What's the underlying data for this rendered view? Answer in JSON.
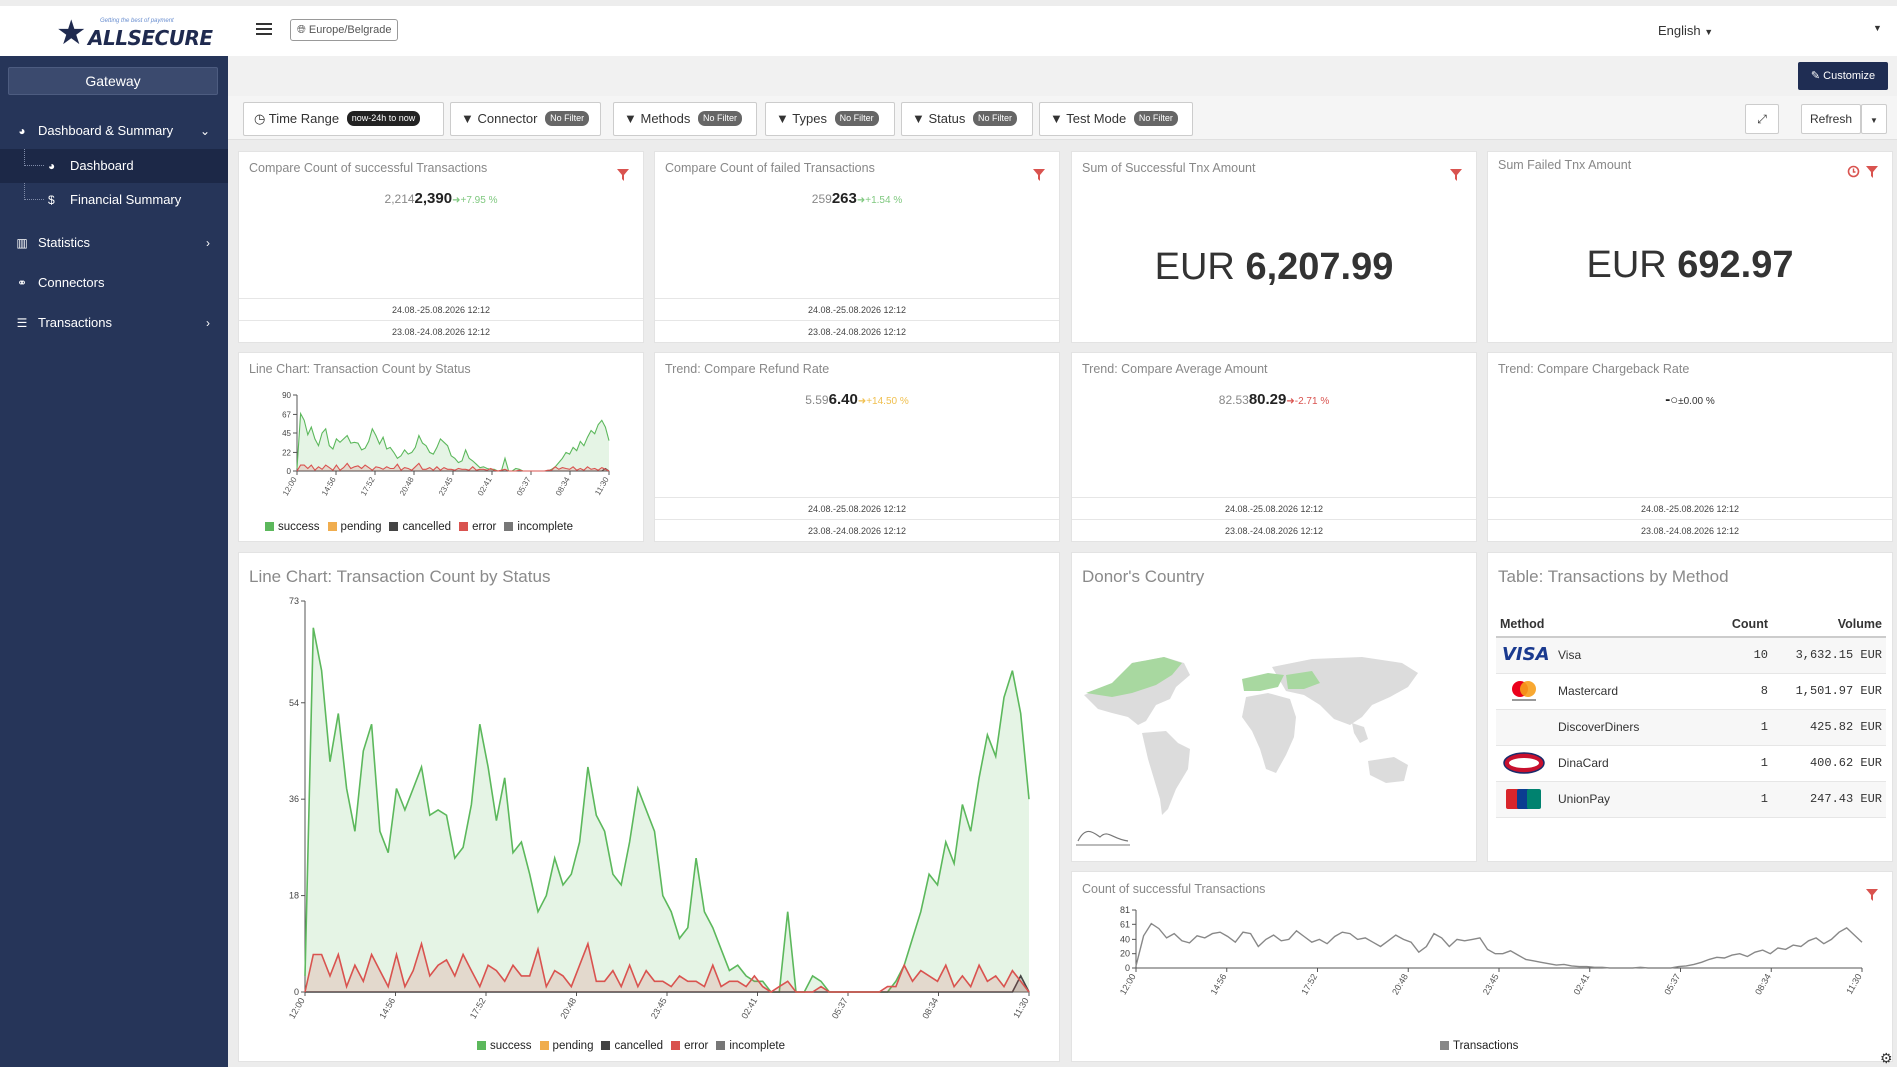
{
  "header": {
    "logo_text": "ALLSECURE",
    "logo_tagline": "Getting the best of payment",
    "timezone": "Europe/Belgrade",
    "language": "English"
  },
  "sidebar": {
    "gateway_label": "Gateway",
    "items": [
      {
        "label": "Dashboard & Summary",
        "icon": "dashboard-icon"
      },
      {
        "label": "Dashboard",
        "icon": "dashboard-icon"
      },
      {
        "label": "Financial Summary",
        "icon": "dollar-icon"
      },
      {
        "label": "Statistics",
        "icon": "bar-chart-icon"
      },
      {
        "label": "Connectors",
        "icon": "link-icon"
      },
      {
        "label": "Transactions",
        "icon": "list-icon"
      }
    ]
  },
  "toolbar": {
    "customize_label": "Customize",
    "filters": [
      {
        "label": "Time Range",
        "badge": "now-24h to now"
      },
      {
        "label": "Connector",
        "badge": "No Filter"
      },
      {
        "label": "Methods",
        "badge": "No Filter"
      },
      {
        "label": "Types",
        "badge": "No Filter"
      },
      {
        "label": "Status",
        "badge": "No Filter"
      },
      {
        "label": "Test Mode",
        "badge": "No Filter"
      }
    ],
    "refresh_label": "Refresh"
  },
  "widgets": {
    "succ_count": {
      "title": "Compare Count of successful Transactions",
      "prev": "2,214",
      "cur": "2,390",
      "change": "+7.95 %",
      "range1": "24.08.-25.08.2026 12:12",
      "range2": "23.08.-24.08.2026 12:12"
    },
    "fail_count": {
      "title": "Compare Count of failed Transactions",
      "prev": "259",
      "cur": "263",
      "change": "+1.54 %",
      "range1": "24.08.-25.08.2026 12:12",
      "range2": "23.08.-24.08.2026 12:12"
    },
    "sum_succ": {
      "title": "Sum of Successful Tnx Amount",
      "currency": "EUR",
      "amount": "6,207.99"
    },
    "sum_fail": {
      "title": "Sum Failed Tnx Amount",
      "currency": "EUR",
      "amount": "692.97"
    },
    "small_line": {
      "title": "Line Chart: Transaction Count by Status"
    },
    "refund": {
      "title": "Trend: Compare Refund Rate",
      "prev": "5.59",
      "cur": "6.40",
      "change": "+14.50 %",
      "range1": "24.08.-25.08.2026 12:12",
      "range2": "23.08.-24.08.2026 12:12"
    },
    "avg_amount": {
      "title": "Trend: Compare Average Amount",
      "prev": "82.53",
      "cur": "80.29",
      "change": "-2.71 %",
      "range1": "24.08.-25.08.2026 12:12",
      "range2": "23.08.-24.08.2026 12:12"
    },
    "chargeback": {
      "title": "Trend: Compare Chargeback Rate",
      "prev": "-",
      "cur": "",
      "change": "±0.00 %",
      "range1": "24.08.-25.08.2026 12:12",
      "range2": "23.08.-24.08.2026 12:12"
    },
    "big_line": {
      "title": "Line Chart: Transaction Count by Status"
    },
    "donor": {
      "title": "Donor's Country"
    },
    "methods_table": {
      "title": "Table: Transactions by Method",
      "headers": [
        "Method",
        "Count",
        "Volume"
      ],
      "rows": [
        {
          "method": "Visa",
          "logo": "visa-logo",
          "count": "10",
          "volume": "3,632.15 EUR"
        },
        {
          "method": "Mastercard",
          "logo": "mastercard-logo",
          "count": "8",
          "volume": "1,501.97 EUR"
        },
        {
          "method": "DiscoverDiners",
          "logo": "",
          "count": "1",
          "volume": "425.82 EUR"
        },
        {
          "method": "DinaCard",
          "logo": "dinacard-logo",
          "count": "1",
          "volume": "400.62 EUR"
        },
        {
          "method": "UnionPay",
          "logo": "unionpay-logo",
          "count": "1",
          "volume": "247.43 EUR"
        }
      ]
    },
    "succ_line": {
      "title": "Count of successful Transactions"
    }
  },
  "chart_data": [
    {
      "type": "area",
      "title": "Line Chart: Transaction Count by Status",
      "x_ticks": [
        "12:00",
        "14:56",
        "17:52",
        "20:48",
        "23:45",
        "02:41",
        "05:37",
        "08:34",
        "11:30"
      ],
      "ylim": [
        0,
        73
      ],
      "y_ticks": [
        0,
        18,
        36,
        54,
        73
      ],
      "series": [
        {
          "name": "success",
          "color": "#5cb85c",
          "values": [
            3,
            68,
            60,
            43,
            52,
            38,
            30,
            45,
            50,
            30,
            26,
            38,
            34,
            38,
            42,
            33,
            34,
            33,
            25,
            27,
            35,
            50,
            42,
            32,
            40,
            26,
            28,
            22,
            15,
            18,
            25,
            20,
            22,
            28,
            42,
            33,
            30,
            22,
            20,
            28,
            38,
            34,
            30,
            18,
            15,
            10,
            12,
            25,
            15,
            12,
            8,
            4,
            5,
            3,
            2,
            2,
            0,
            0,
            15,
            0,
            0,
            3,
            2,
            0,
            0,
            0,
            0,
            0,
            0,
            0,
            0,
            2,
            5,
            10,
            15,
            22,
            20,
            28,
            24,
            35,
            30,
            40,
            48,
            44,
            55,
            60,
            52,
            36
          ]
        },
        {
          "name": "pending",
          "color": "#f0ad4e",
          "values": []
        },
        {
          "name": "cancelled",
          "color": "#444444",
          "values": [
            0,
            0,
            0,
            0,
            0,
            0,
            0,
            0,
            0,
            0,
            0,
            0,
            0,
            0,
            0,
            0,
            0,
            0,
            0,
            0,
            0,
            0,
            0,
            0,
            0,
            0,
            0,
            0,
            0,
            0,
            0,
            0,
            0,
            0,
            0,
            0,
            0,
            0,
            0,
            0,
            0,
            0,
            0,
            0,
            0,
            0,
            0,
            0,
            0,
            0,
            0,
            0,
            0,
            0,
            0,
            0,
            0,
            0,
            0,
            0,
            0,
            0,
            0,
            0,
            0,
            0,
            0,
            0,
            0,
            0,
            0,
            0,
            0,
            0,
            0,
            0,
            0,
            0,
            0,
            0,
            0,
            0,
            0,
            0,
            0,
            0,
            3,
            0
          ]
        },
        {
          "name": "error",
          "color": "#d9534f",
          "values": [
            0,
            7,
            7,
            3,
            7,
            1,
            5,
            2,
            7,
            4,
            1,
            7,
            1,
            4,
            9,
            3,
            5,
            6,
            3,
            7,
            4,
            1,
            5,
            4,
            2,
            5,
            3,
            3,
            8,
            1,
            4,
            3,
            1,
            5,
            9,
            2,
            2,
            4,
            1,
            5,
            1,
            4,
            2,
            2,
            1,
            3,
            2,
            2,
            1,
            5,
            1,
            2,
            2,
            1,
            3,
            1,
            0,
            1,
            2,
            0,
            0,
            0,
            1,
            0,
            0,
            0,
            0,
            0,
            0,
            0,
            1,
            1,
            5,
            2,
            4,
            3,
            2,
            5,
            1,
            3,
            1,
            5,
            2,
            3,
            1,
            4,
            2,
            0
          ]
        },
        {
          "name": "incomplete",
          "color": "#777777",
          "values": []
        }
      ]
    },
    {
      "type": "line",
      "title": "Count of successful Transactions",
      "x_ticks": [
        "12:00",
        "14:56",
        "17:52",
        "20:48",
        "23:45",
        "02:41",
        "05:37",
        "08:34",
        "11:30"
      ],
      "ylim": [
        0,
        81
      ],
      "y_ticks": [
        0,
        20,
        40,
        61,
        81
      ],
      "series": [
        {
          "name": "Transactions",
          "color": "#888888",
          "values": [
            3,
            45,
            62,
            55,
            42,
            48,
            38,
            35,
            45,
            42,
            48,
            50,
            44,
            36,
            50,
            48,
            30,
            40,
            46,
            38,
            40,
            52,
            44,
            36,
            40,
            34,
            44,
            50,
            48,
            40,
            42,
            36,
            30,
            38,
            46,
            40,
            36,
            22,
            30,
            48,
            42,
            30,
            40,
            38,
            40,
            42,
            26,
            20,
            20,
            24,
            18,
            12,
            10,
            8,
            6,
            4,
            5,
            3,
            2,
            2,
            1,
            1,
            0,
            0,
            0,
            0,
            1,
            0,
            0,
            0,
            0,
            2,
            3,
            5,
            8,
            12,
            15,
            14,
            18,
            20,
            16,
            22,
            25,
            20,
            28,
            26,
            32,
            30,
            38,
            42,
            34,
            40,
            50,
            56,
            46,
            36
          ]
        }
      ]
    }
  ]
}
